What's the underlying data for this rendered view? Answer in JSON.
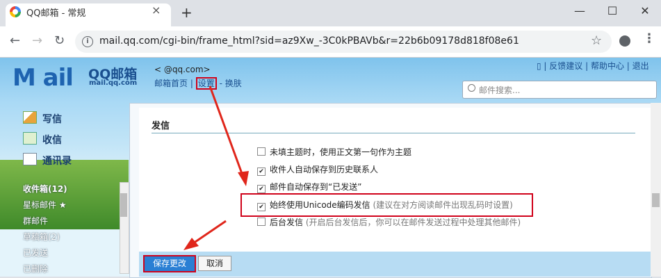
{
  "browser": {
    "tab_title": "QQ邮箱 - 常规",
    "tab_close": "×",
    "new_tab": "+",
    "url": "mail.qq.com/cgi-bin/frame_html?sid=az9Xw_-3C0kPBAVb&r=22b6b09178d818f08e61",
    "window_buttons": {
      "minimize": "—",
      "maximize": "☐",
      "close": "✕"
    },
    "nav": {
      "back": "←",
      "forward": "→",
      "reload": "↻"
    },
    "star": "☆",
    "menu": "⋮"
  },
  "header": {
    "logo_text": "M ail",
    "logo_cn": "QQ邮箱",
    "logo_domain": "mail.qq.com",
    "account_email": "<        @qq.com>",
    "links": {
      "home": "邮箱首页",
      "sep": "|",
      "settings": "设置",
      "dash": "-",
      "skin": "换肤"
    },
    "right_links": "▯ | 反馈建议 | 帮助中心 | 退出",
    "search_placeholder": "邮件搜索..."
  },
  "sidebar": {
    "actions": [
      {
        "label": "写信",
        "icon": "compose-icon"
      },
      {
        "label": "收信",
        "icon": "inbox-icon"
      },
      {
        "label": "通讯录",
        "icon": "contacts-icon"
      }
    ],
    "folders": [
      {
        "label": "收件箱(12)"
      },
      {
        "label": "星标邮件 ★"
      },
      {
        "label": "群邮件"
      },
      {
        "label": "草稿箱(2)"
      },
      {
        "label": "已发送"
      },
      {
        "label": "已删除"
      }
    ]
  },
  "settings": {
    "section_title": "发信",
    "options": [
      {
        "label": "未填主题时，使用正文第一句作为主题",
        "checked": false,
        "hint": ""
      },
      {
        "label": "收件人自动保存到历史联系人",
        "checked": true,
        "hint": ""
      },
      {
        "label": "邮件自动保存到“已发送”",
        "checked": true,
        "hint": ""
      },
      {
        "label": "始终使用Unicode编码发信",
        "checked": true,
        "hint": "(建议在对方阅读邮件出现乱码时设置)"
      },
      {
        "label": "后台发信",
        "checked": false,
        "hint": "(开启后台发信后，你可以在邮件发送过程中处理其他邮件)"
      }
    ],
    "save_label": "保存更改",
    "cancel_label": "取消"
  },
  "colors": {
    "highlight": "#d0021b",
    "primary_button": "#2a7fd4",
    "link": "#1a4f8f"
  }
}
